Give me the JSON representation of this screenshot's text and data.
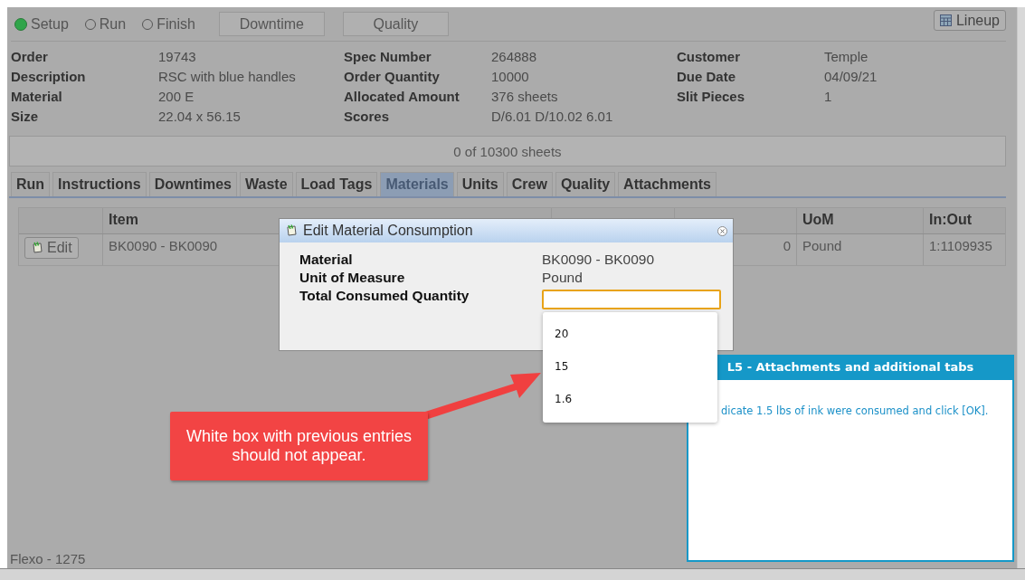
{
  "status_options": [
    {
      "label": "Setup",
      "selected": true
    },
    {
      "label": "Run",
      "selected": false
    },
    {
      "label": "Finish",
      "selected": false
    }
  ],
  "toolbar_buttons": [
    "Downtime",
    "Quality"
  ],
  "lineup_button": "Lineup",
  "order_info": [
    [
      {
        "label": "Order",
        "value": "19743"
      },
      {
        "label": "Spec Number",
        "value": "264888"
      },
      {
        "label": "Customer",
        "value": "Temple"
      }
    ],
    [
      {
        "label": "Description",
        "value": "RSC with blue handles"
      },
      {
        "label": "Order Quantity",
        "value": "10000"
      },
      {
        "label": "Due Date",
        "value": "04/09/21"
      }
    ],
    [
      {
        "label": "Material",
        "value": "200 E"
      },
      {
        "label": "Allocated Amount",
        "value": "376 sheets"
      },
      {
        "label": "Slit Pieces",
        "value": "1"
      }
    ],
    [
      {
        "label": "Size",
        "value": "22.04 x 56.15"
      },
      {
        "label": "Scores",
        "value": "D/6.01 D/10.02 6.01"
      }
    ]
  ],
  "progress": {
    "text": "0 of 10300 sheets",
    "level": 0
  },
  "tabs": [
    {
      "label": "Run",
      "selected": false
    },
    {
      "label": "Instructions",
      "selected": false
    },
    {
      "label": "Downtimes",
      "selected": false
    },
    {
      "label": "Waste",
      "selected": false
    },
    {
      "label": "Load Tags",
      "selected": false
    },
    {
      "label": "Materials",
      "selected": true
    },
    {
      "label": "Units",
      "selected": false
    },
    {
      "label": "Crew",
      "selected": false
    },
    {
      "label": "Quality",
      "selected": false
    },
    {
      "label": "Attachments",
      "selected": false
    }
  ],
  "table": {
    "columns": [
      "",
      "Item",
      "",
      "",
      "UoM",
      "In:Out"
    ],
    "rows": [
      {
        "button": "Edit",
        "item": "BK0090 - BK0090",
        "actual": "0",
        "uom": "Pound",
        "in_out": "1:1109935"
      }
    ]
  },
  "footer": "Flexo - 1275",
  "dialog": {
    "title": "Edit Material Consumption",
    "fields": [
      {
        "label": "Material",
        "value": "BK0090 - BK0090"
      },
      {
        "label": "Unit of Measure",
        "value": "Pound"
      }
    ],
    "input_label": "Total Consumed Quantity",
    "suggestions": [
      "20",
      "15",
      "1.6"
    ]
  },
  "tutorial": {
    "title": "L5 - Attachments and additional tabs",
    "text": "dicate 1.5 lbs of ink were consumed and click [OK]."
  },
  "callout": "White box with previous entries should not appear."
}
